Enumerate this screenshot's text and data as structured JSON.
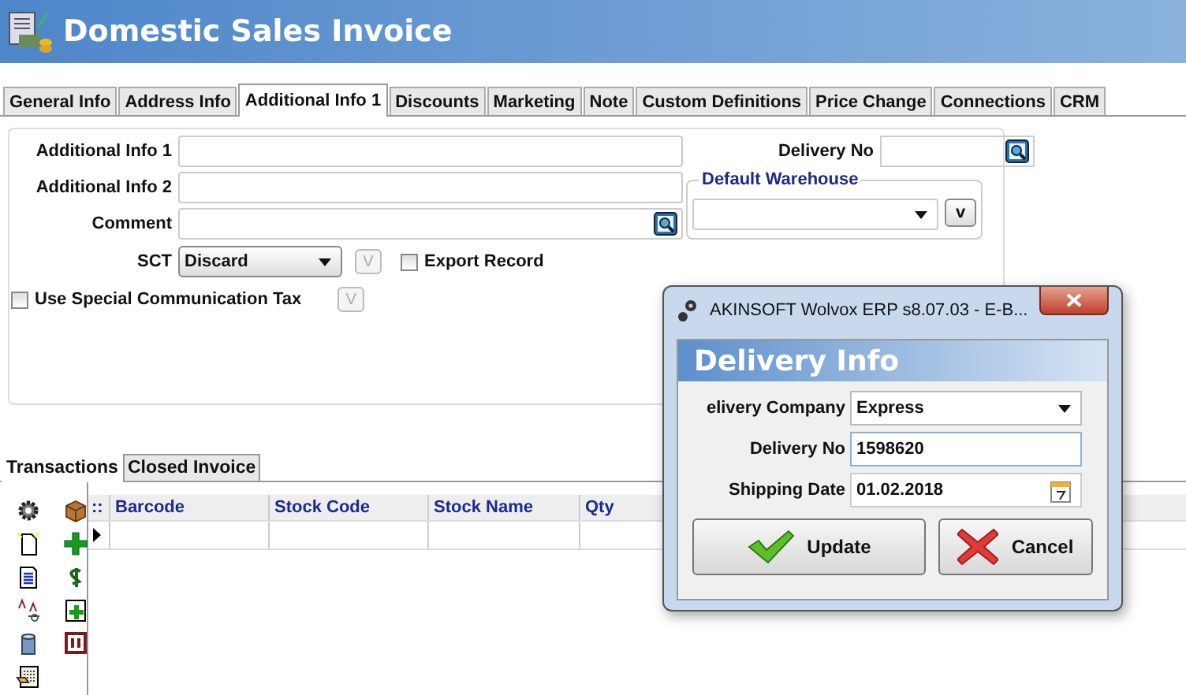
{
  "window": {
    "title": "Domestic Sales Invoice"
  },
  "tabs": [
    {
      "label": "General Info",
      "selected": false
    },
    {
      "label": "Address Info",
      "selected": false
    },
    {
      "label": "Additional Info 1",
      "selected": true
    },
    {
      "label": "Discounts",
      "selected": false
    },
    {
      "label": "Marketing",
      "selected": false
    },
    {
      "label": "Note",
      "selected": false
    },
    {
      "label": "Custom Definitions",
      "selected": false
    },
    {
      "label": "Price Change",
      "selected": false
    },
    {
      "label": "Connections",
      "selected": false
    },
    {
      "label": "CRM",
      "selected": false
    }
  ],
  "form": {
    "fields": [
      {
        "label": "Additional Info 1",
        "kind": "text"
      },
      {
        "label": "Additional Info 2",
        "kind": "text"
      },
      {
        "label": "Comment",
        "kind": "lookup"
      }
    ],
    "sct": {
      "label": "SCT",
      "value": "Discard",
      "button": {
        "label": "V",
        "disabled": true
      }
    },
    "export_record": {
      "label": "Export Record",
      "checked": false
    },
    "use_special_communication_tax": {
      "label": "Use Special Communication Tax",
      "checked": false,
      "button": {
        "label": "V",
        "disabled": true
      }
    },
    "delivery_no": {
      "label": "Delivery No"
    },
    "default_warehouse": {
      "title": "Default Warehouse",
      "button": {
        "label": "v",
        "disabled": false
      }
    }
  },
  "bottom_tabs": [
    {
      "label": "Transactions",
      "selected": true
    },
    {
      "label": "Closed Invoice",
      "selected": false
    }
  ],
  "grid": {
    "corner": "::",
    "columns": [
      "Barcode",
      "Stock Code",
      "Stock Name",
      "Qty"
    ]
  },
  "dialog": {
    "title": "AKINSOFT Wolvox ERP s8.07.03 - E-B...",
    "header": "Delivery Info",
    "fields": [
      {
        "label": "elivery Company",
        "value": "Express",
        "kind": "select"
      },
      {
        "label": "Delivery No",
        "value": "1598620",
        "kind": "text"
      },
      {
        "label": "Shipping Date",
        "value": "01.02.2018",
        "kind": "date"
      }
    ],
    "buttons": [
      {
        "label": "Update",
        "kind": "ok"
      },
      {
        "label": "Cancel",
        "kind": "cancel"
      }
    ]
  }
}
